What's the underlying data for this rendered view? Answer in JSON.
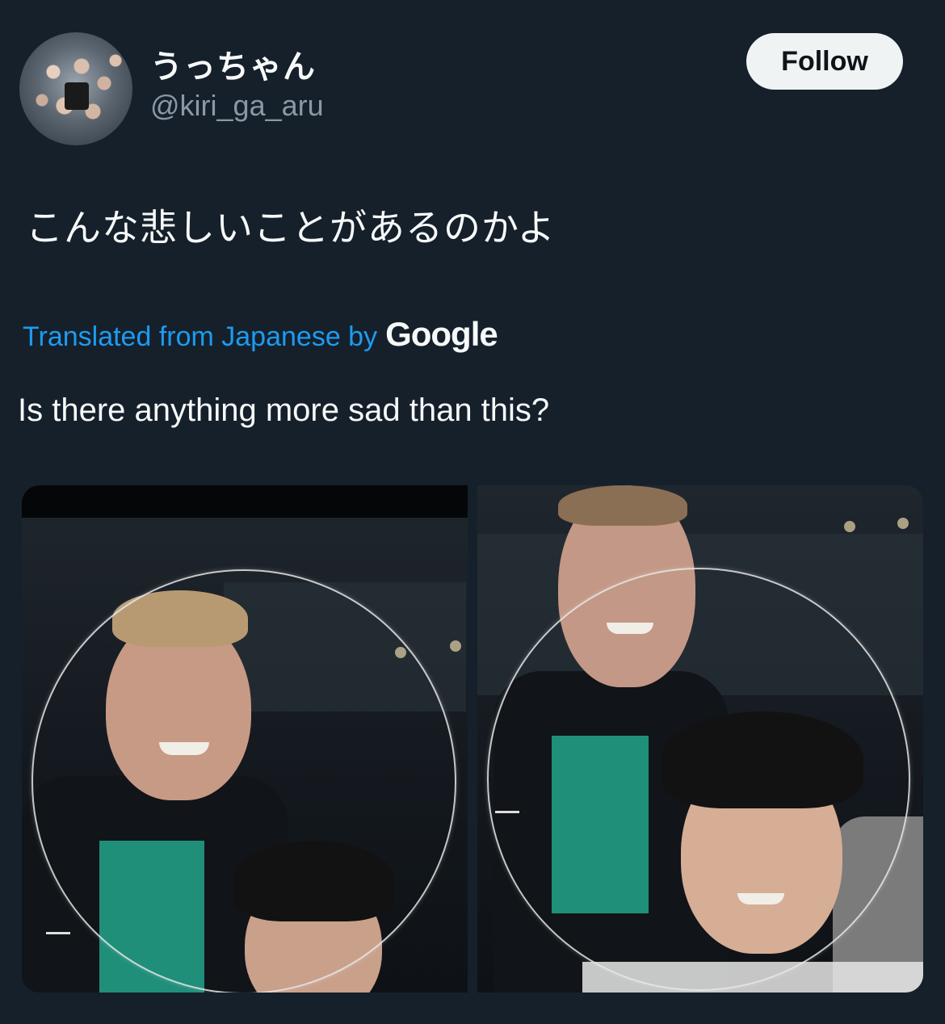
{
  "author": {
    "display_name": "うっちゃん",
    "handle": "@kiri_ga_aru"
  },
  "follow_button": {
    "label": "Follow"
  },
  "tweet": {
    "text": "こんな悲しいことがあるのかよ"
  },
  "translation": {
    "label": "Translated from Japanese by",
    "provider": "Google",
    "text": "Is there anything more sad than this?"
  },
  "media": {
    "count": 2
  },
  "colors": {
    "background": "#15202b",
    "link": "#1d9bf0",
    "muted": "#8b98a5",
    "button_bg": "#eff3f4"
  }
}
